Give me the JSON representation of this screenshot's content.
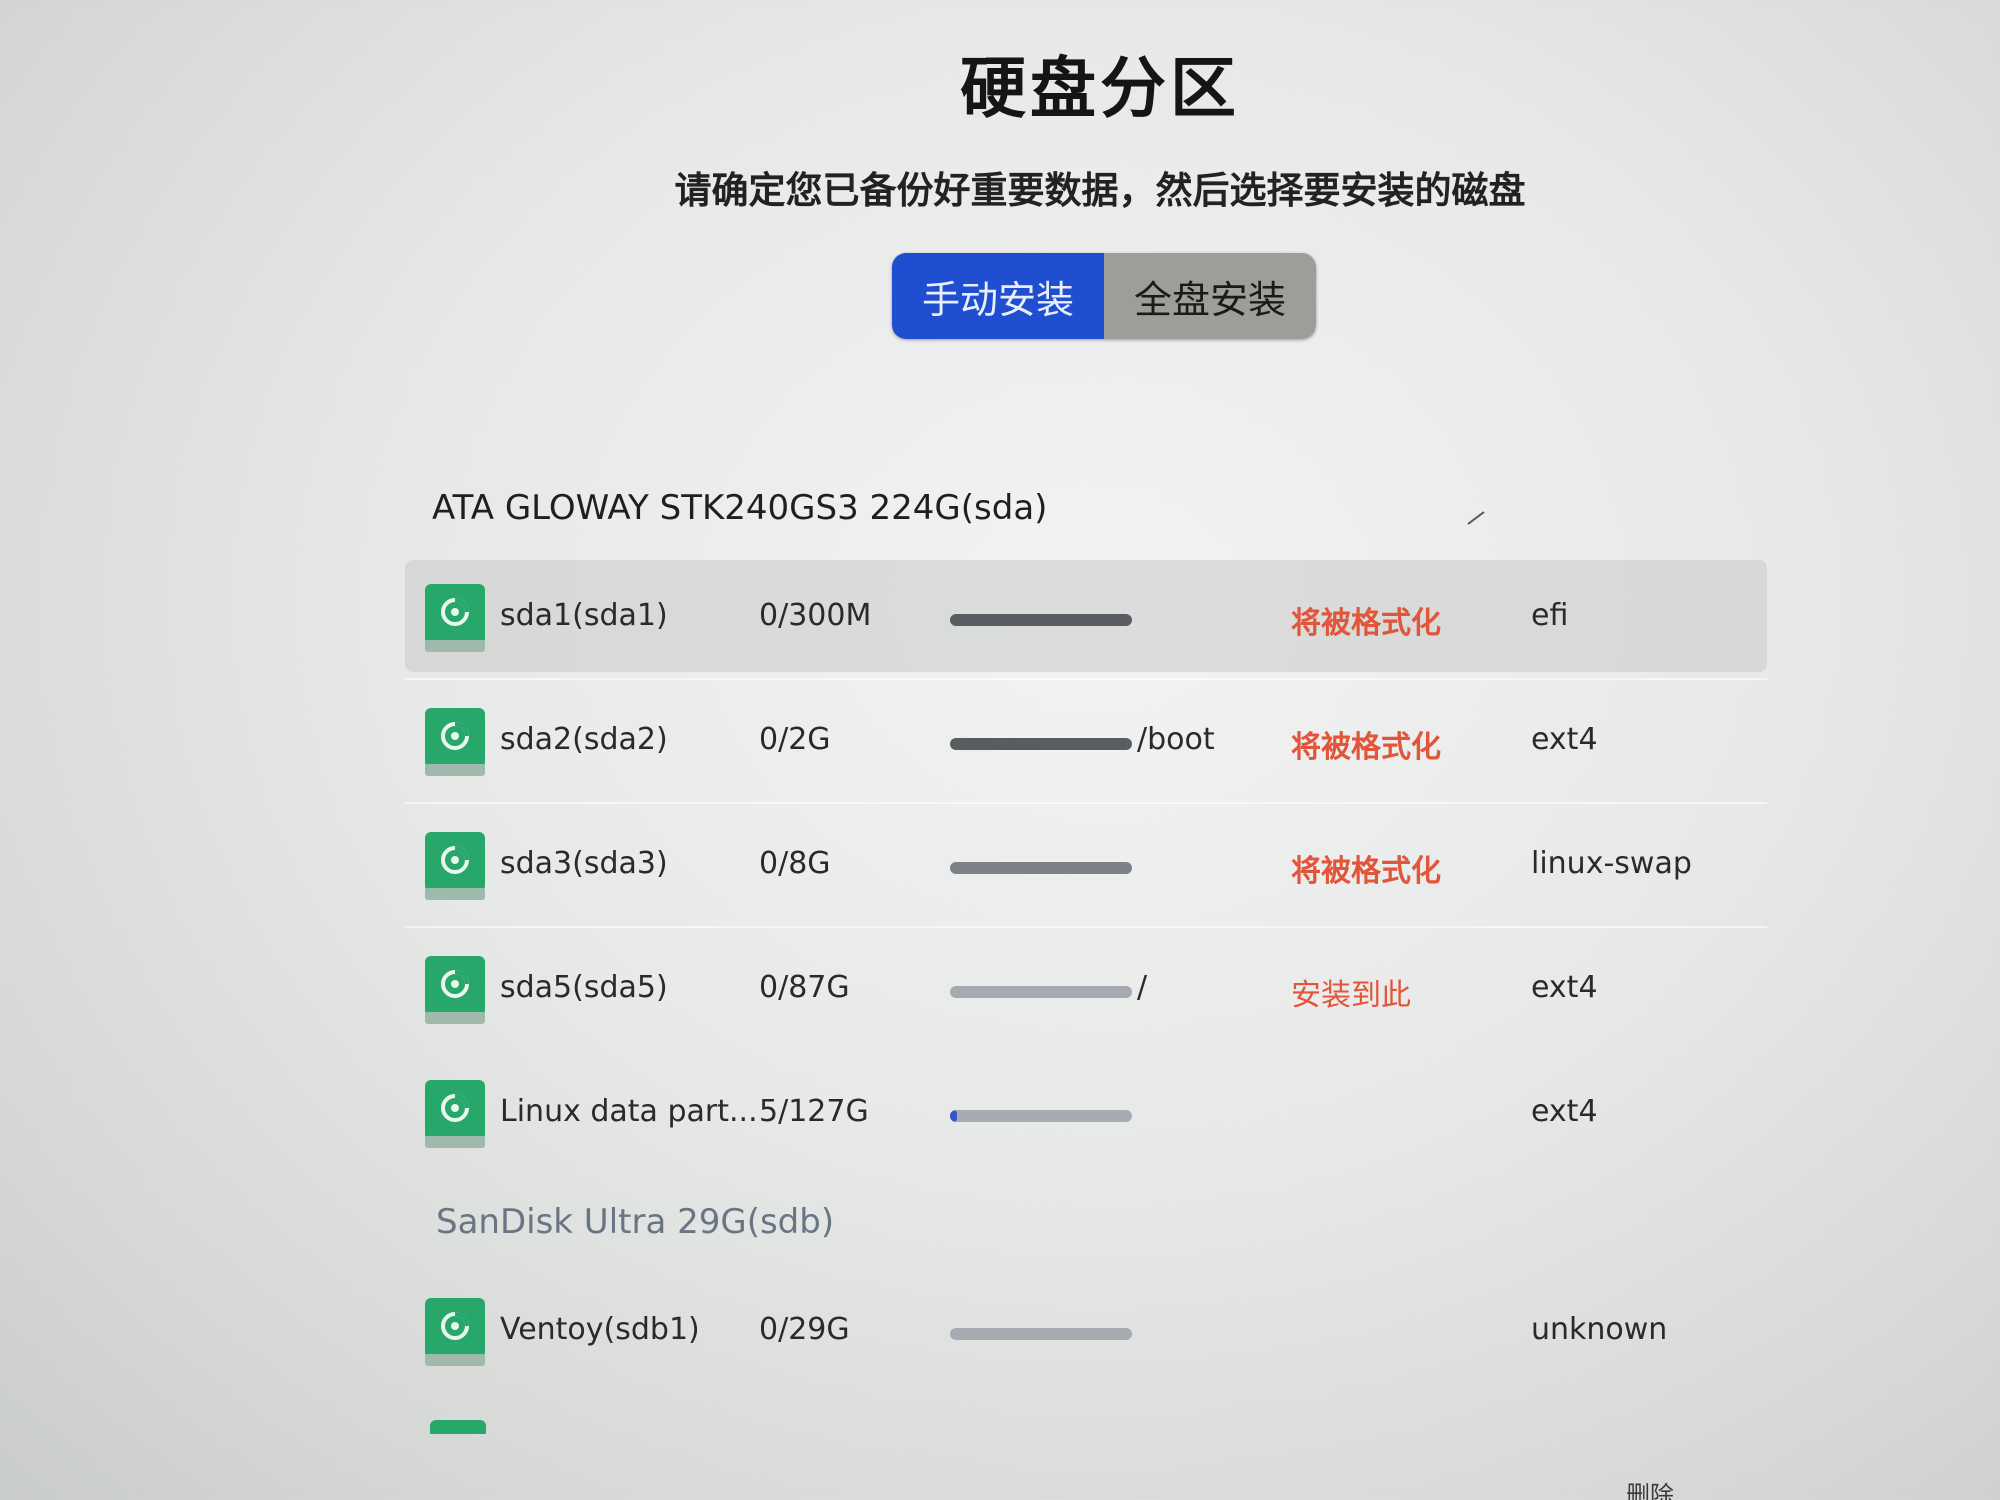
{
  "page": {
    "title": "硬盘分区",
    "subtitle": "请确定您已备份好重要数据，然后选择要安装的磁盘"
  },
  "mode_switch": {
    "manual_label": "手动安装",
    "full_label": "全盘安装",
    "selected": "manual"
  },
  "disks": [
    {
      "header": "ATA GLOWAY STK240GS3 224G(sda)",
      "partitions": [
        {
          "name": "sda1(sda1)",
          "usage": "0/300M",
          "used_fraction": 0.0,
          "mount": "",
          "action": "将被格式化",
          "fs": "efi",
          "selected": true
        },
        {
          "name": "sda2(sda2)",
          "usage": "0/2G",
          "used_fraction": 0.0,
          "mount": "/boot",
          "action": "将被格式化",
          "fs": "ext4",
          "selected": false
        },
        {
          "name": "sda3(sda3)",
          "usage": "0/8G",
          "used_fraction": 0.0,
          "mount": "",
          "action": "将被格式化",
          "fs": "linux-swap",
          "selected": false
        },
        {
          "name": "sda5(sda5)",
          "usage": "0/87G",
          "used_fraction": 0.0,
          "mount": "/",
          "action": "安装到此",
          "fs": "ext4",
          "selected": false
        },
        {
          "name": "Linux data part...",
          "usage": "5/127G",
          "used_fraction": 0.04,
          "mount": "",
          "action": "",
          "fs": "ext4",
          "selected": false
        }
      ]
    },
    {
      "header": "SanDisk Ultra 29G(sdb)",
      "partitions": [
        {
          "name": "Ventoy(sdb1)",
          "usage": "0/29G",
          "used_fraction": 0.0,
          "mount": "",
          "action": "",
          "fs": "unknown",
          "selected": false
        }
      ]
    }
  ],
  "footer": {
    "delete_label": "删除"
  },
  "colors": {
    "accent": "#1f4fd0",
    "warning": "#e2553a",
    "partition_icon": "#27a86a"
  }
}
